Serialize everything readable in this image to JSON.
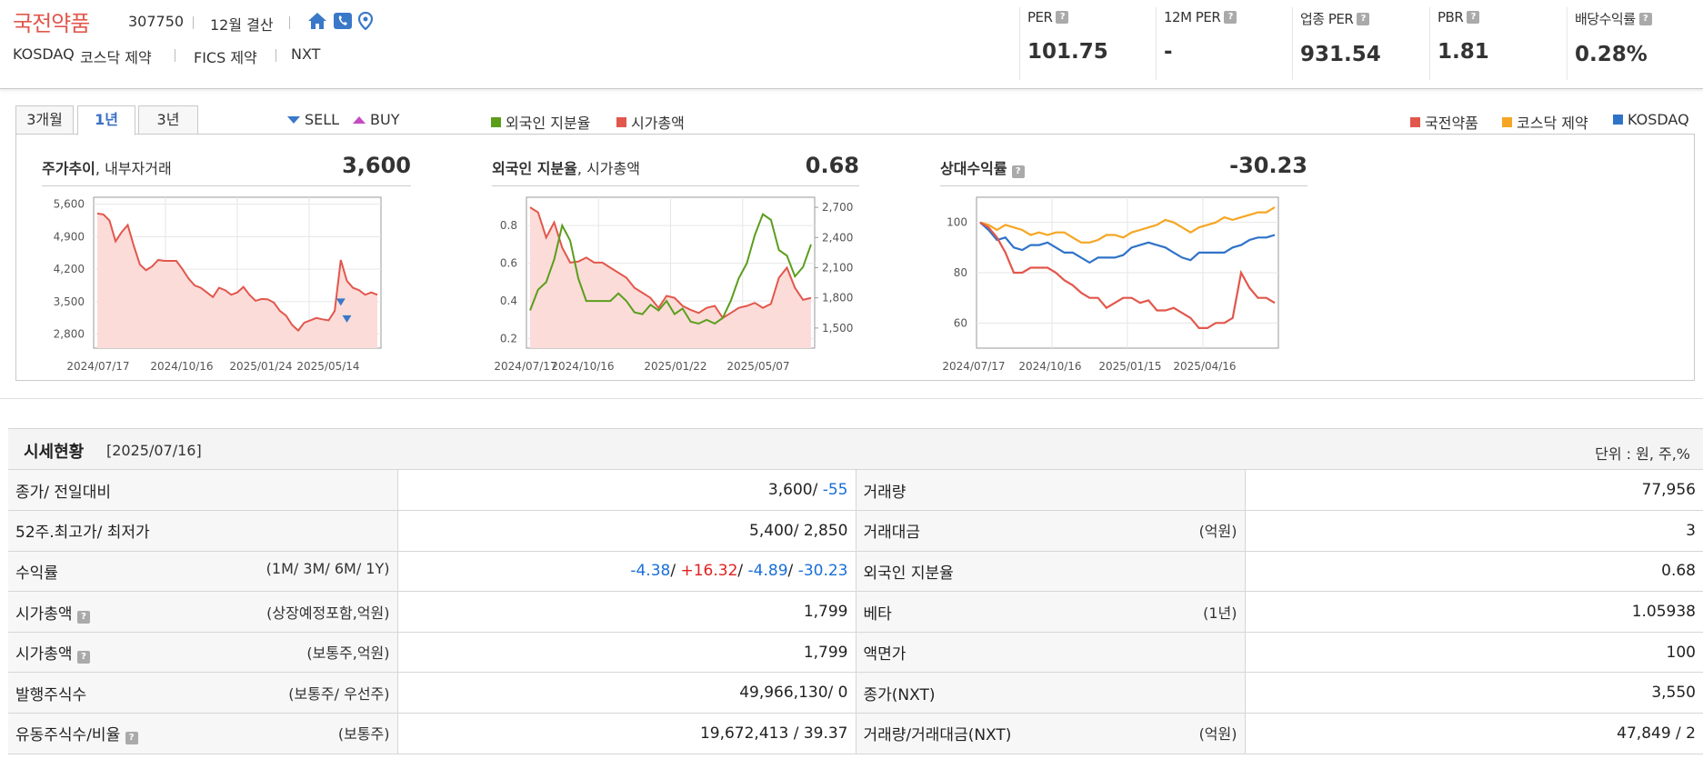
{
  "company": {
    "name": "국전약품",
    "code": "307750",
    "fiscal": "12월 결산",
    "market": "KOSDAQ",
    "industry": "코스닥 제약",
    "fics": "FICS 제약",
    "nxt": "NXT"
  },
  "metrics": [
    {
      "label": "PER",
      "value": "101.75"
    },
    {
      "label": "12M PER",
      "value": "-"
    },
    {
      "label": "업종 PER",
      "value": "931.54"
    },
    {
      "label": "PBR",
      "value": "1.81"
    },
    {
      "label": "배당수익률",
      "value": "0.28%"
    }
  ],
  "tabs": [
    "3개월",
    "1년",
    "3년"
  ],
  "active_tab": "1년",
  "legend_left": {
    "sell": "SELL",
    "buy": "BUY"
  },
  "legend_mid": {
    "foreign": "외국인 지분율",
    "mktcap": "시가총액"
  },
  "legend_right": {
    "a": "국전약품",
    "b": "코스닥 제약",
    "c": "KOSDAQ"
  },
  "colors": {
    "red": "#e2574c",
    "green": "#5a9e1c",
    "orange": "#f5a623",
    "blue": "#2f73c8",
    "fill": "#fbdcd9"
  },
  "chart_data": [
    {
      "type": "area",
      "title": "주가추이",
      "title_extra": ", 내부자거래",
      "value": "3,600",
      "x": [
        "2024/07/17",
        "2024/10/16",
        "2025/01/24",
        "2025/05/14"
      ],
      "yticks": [
        "5,600",
        "4,900",
        "4,200",
        "3,500",
        "2,800"
      ],
      "ylim": [
        2500,
        5750
      ],
      "series": [
        {
          "values": [
            5400,
            5380,
            5250,
            4800,
            5000,
            5150,
            4700,
            4300,
            4180,
            4260,
            4400,
            4380,
            4380,
            4380,
            4200,
            4000,
            3850,
            3800,
            3700,
            3600,
            3800,
            3750,
            3650,
            3700,
            3820,
            3650,
            3520,
            3560,
            3550,
            3480,
            3300,
            3200,
            3000,
            2880,
            3050,
            3100,
            3150,
            3120,
            3100,
            3300,
            4400,
            3950,
            3800,
            3750,
            3650,
            3700,
            3650
          ]
        }
      ],
      "markers": {
        "sell": [
          {
            "i": 40,
            "v": 3490
          },
          {
            "i": 41,
            "v": 3130
          }
        ]
      }
    },
    {
      "type": "line",
      "title": "외국인 지분율",
      "title_extra": ", 시가총액",
      "value": "0.68",
      "x": [
        "2024/07/17",
        "2024/10/16",
        "2025/01/22",
        "2025/05/07"
      ],
      "yticks_left": [
        "0.8",
        "0.6",
        "0.4",
        "0.2"
      ],
      "ylim_left": [
        0.15,
        0.95
      ],
      "yticks_right": [
        "2,700",
        "2,400",
        "2,100",
        "1,800",
        "1,500"
      ],
      "ylim_right": [
        1300,
        2800
      ],
      "series": [
        {
          "name": "외국인 지분율",
          "values": [
            0.35,
            0.46,
            0.5,
            0.62,
            0.8,
            0.72,
            0.52,
            0.4,
            0.4,
            0.4,
            0.4,
            0.44,
            0.4,
            0.34,
            0.33,
            0.38,
            0.35,
            0.4,
            0.33,
            0.36,
            0.29,
            0.28,
            0.3,
            0.28,
            0.31,
            0.4,
            0.52,
            0.6,
            0.75,
            0.86,
            0.83,
            0.67,
            0.64,
            0.53,
            0.58,
            0.7
          ]
        },
        {
          "name": "시가총액",
          "values": [
            2700,
            2650,
            2400,
            2550,
            2300,
            2150,
            2160,
            2200,
            2150,
            2150,
            2100,
            2050,
            2000,
            1900,
            1850,
            1800,
            1700,
            1820,
            1800,
            1720,
            1680,
            1650,
            1700,
            1720,
            1600,
            1650,
            1700,
            1720,
            1750,
            1700,
            1740,
            2000,
            2100,
            1900,
            1780,
            1800
          ]
        }
      ]
    },
    {
      "type": "line",
      "title": "상대수익률",
      "value": "-30.23",
      "x": [
        "2024/07/17",
        "2024/10/16",
        "2025/01/15",
        "2025/04/16"
      ],
      "yticks": [
        "100",
        "80",
        "60"
      ],
      "ylim": [
        50,
        110
      ],
      "series": [
        {
          "name": "국전약품",
          "values": [
            100,
            98,
            94,
            88,
            80,
            80,
            82,
            82,
            82,
            80,
            77,
            75,
            72,
            70,
            70,
            66,
            68,
            70,
            70,
            68,
            69,
            65,
            65,
            66,
            64,
            62,
            58,
            58,
            60,
            60,
            62,
            80,
            74,
            70,
            70,
            68
          ]
        },
        {
          "name": "코스닥 제약",
          "values": [
            100,
            99,
            97,
            99,
            98,
            97,
            95,
            96,
            95,
            96,
            96,
            94,
            92,
            92,
            93,
            95,
            95,
            94,
            96,
            97,
            98,
            99,
            101,
            100,
            98,
            96,
            98,
            99,
            100,
            102,
            101,
            102,
            103,
            104,
            104,
            106
          ]
        },
        {
          "name": "KOSDAQ",
          "values": [
            100,
            97,
            93,
            94,
            90,
            89,
            91,
            91,
            92,
            90,
            88,
            88,
            86,
            84,
            86,
            86,
            86,
            87,
            90,
            91,
            92,
            91,
            90,
            88,
            86,
            85,
            88,
            88,
            88,
            88,
            90,
            91,
            93,
            94,
            94,
            95
          ]
        }
      ]
    }
  ],
  "section": {
    "title": "시세현황",
    "date": "[2025/07/16]",
    "unit": "단위 : 원, 주,%"
  },
  "rows": [
    {
      "l1": "종가/ 전일대비",
      "s1": "",
      "v1a": "3,600/ ",
      "v1b": "-55",
      "l2": "거래량",
      "s2": "",
      "v2": "77,956"
    },
    {
      "l1": "52주.최고가/ 최저가",
      "s1": "",
      "v1a": "5,400/ 2,850",
      "v1b": "",
      "l2": "거래대금",
      "s2": "(억원)",
      "v2": "3"
    },
    {
      "l1": "수익률",
      "s1": "(1M/ 3M/ 6M/ 1Y)",
      "r1": "-4.38",
      "r2": "+16.32",
      "r3": "-4.89",
      "r4": "-30.23",
      "l2": "외국인 지분율",
      "s2": "",
      "v2": "0.68"
    },
    {
      "l1": "시가총액",
      "s1": "(상장예정포함,억원)",
      "v1a": "1,799",
      "v1b": "",
      "l2": "베타",
      "s2": "(1년)",
      "v2": "1.05938"
    },
    {
      "l1": "시가총액",
      "s1": "(보통주,억원)",
      "v1a": "1,799",
      "v1b": "",
      "l2": "액면가",
      "s2": "",
      "v2": "100"
    },
    {
      "l1": "발행주식수",
      "s1": "(보통주/ 우선주)",
      "v1a": "49,966,130/ 0",
      "v1b": "",
      "l2": "종가(NXT)",
      "s2": "",
      "v2": "3,550"
    },
    {
      "l1": "유동주식수/비율",
      "s1": "(보통주)",
      "v1a": "19,672,413 / 39.37",
      "v1b": "",
      "l2": "거래량/거래대금(NXT)",
      "s2": "(억원)",
      "v2": "47,849 / 2"
    }
  ]
}
